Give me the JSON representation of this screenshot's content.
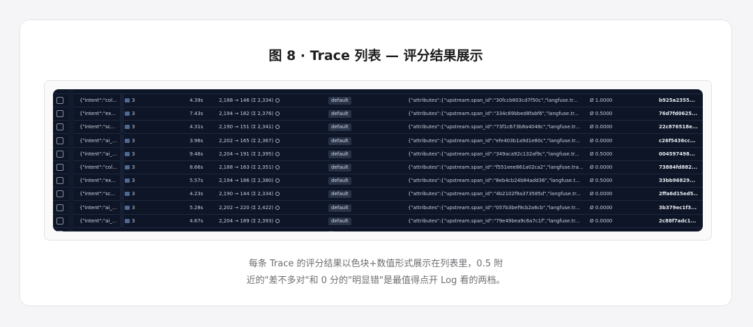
{
  "figure": {
    "title": "图 8 · Trace 列表 — 评分结果展示",
    "caption_line1": "每条 Trace 的评分结果以色块+数值形式展示在列表里，0.5 附",
    "caption_line2": "近的\"差不多对\"和 0 分的\"明显错\"是最值得点开 Log 看的两档。"
  },
  "colors": {
    "table_bg": "#0d1526",
    "row_border": "#1f2a3f",
    "badge_bg": "#283348",
    "metadata_swatch": "#4f6a92"
  },
  "table": {
    "rows": [
      {
        "input": "{\"intent\":\"col...",
        "meta": "3",
        "latency": "4.39s",
        "tokens": "2,188 → 146 (Σ 2,334)",
        "env": "default",
        "attrs": "{\"attributes\":{\"upstream.span_id\":\"30fccb803cd7f50c\",\"langfuse.tr...",
        "score": "Ø 1.0000",
        "trace_id": "b925a2355..."
      },
      {
        "input": "{\"intent\":\"ex...",
        "meta": "3",
        "latency": "7.43s",
        "tokens": "2,194 → 182 (Σ 2,376)",
        "env": "default",
        "attrs": "{\"attributes\":{\"upstream.span_id\":\"334c69bbed8fabf6\",\"langfuse.tr...",
        "score": "Ø 0.5000",
        "trace_id": "76d7fd0625..."
      },
      {
        "input": "{\"intent\":\"sc...",
        "meta": "3",
        "latency": "4.31s",
        "tokens": "2,190 → 151 (Σ 2,341)",
        "env": "default",
        "attrs": "{\"attributes\":{\"upstream.span_id\":\"73f1c673b8a4048c\",\"langfuse.tr...",
        "score": "Ø 0.0000",
        "trace_id": "22c876518e..."
      },
      {
        "input": "{\"intent\":\"ai_...",
        "meta": "3",
        "latency": "3.96s",
        "tokens": "2,202 → 165 (Σ 2,367)",
        "env": "default",
        "attrs": "{\"attributes\":{\"upstream.span_id\":\"efe403b1a9d1e80c\",\"langfuse.tr...",
        "score": "Ø 0.0000",
        "trace_id": "c26f5436cc..."
      },
      {
        "input": "{\"intent\":\"ai_...",
        "meta": "3",
        "latency": "9.46s",
        "tokens": "2,204 → 191 (Σ 2,395)",
        "env": "default",
        "attrs": "{\"attributes\":{\"upstream.span_id\":\"349aca92c132af9c\",\"langfuse.tr...",
        "score": "Ø 0.5000",
        "trace_id": "004597498..."
      },
      {
        "input": "{\"intent\":\"col...",
        "meta": "3",
        "latency": "8.66s",
        "tokens": "2,188 → 163 (Σ 2,351)",
        "env": "default",
        "attrs": "{\"attributes\":{\"upstream.span_id\":\"f551eee861a02ca2\",\"langfuse.tra...",
        "score": "Ø 0.0000",
        "trace_id": "73884fd882..."
      },
      {
        "input": "{\"intent\":\"ex...",
        "meta": "3",
        "latency": "5.57s",
        "tokens": "2,194 → 186 (Σ 2,380)",
        "env": "default",
        "attrs": "{\"attributes\":{\"upstream.span_id\":\"8eb4cb24b84add36\",\"langfuse.t...",
        "score": "Ø 0.5000",
        "trace_id": "33bb96829..."
      },
      {
        "input": "{\"intent\":\"sc...",
        "meta": "3",
        "latency": "4.23s",
        "tokens": "2,190 → 144 (Σ 2,334)",
        "env": "default",
        "attrs": "{\"attributes\":{\"upstream.span_id\":\"4b2102f9a373585d\",\"langfuse.tr...",
        "score": "Ø 0.0000",
        "trace_id": "2ffa6d15ed5..."
      },
      {
        "input": "{\"intent\":\"ai_...",
        "meta": "3",
        "latency": "5.28s",
        "tokens": "2,202 → 220 (Σ 2,422)",
        "env": "default",
        "attrs": "{\"attributes\":{\"upstream.span_id\":\"057b3bef9cb2a6cb\",\"langfuse.tr...",
        "score": "Ø 0.0000",
        "trace_id": "3b379ec1f3..."
      },
      {
        "input": "{\"intent\":\"ai_...",
        "meta": "3",
        "latency": "4.67s",
        "tokens": "2,204 → 189 (Σ 2,393)",
        "env": "default",
        "attrs": "{\"attributes\":{\"upstream.span_id\":\"79e49bea9c6a7c1f\",\"langfuse.tr...",
        "score": "Ø 0.0000",
        "trace_id": "2c88f7adc1..."
      }
    ]
  }
}
